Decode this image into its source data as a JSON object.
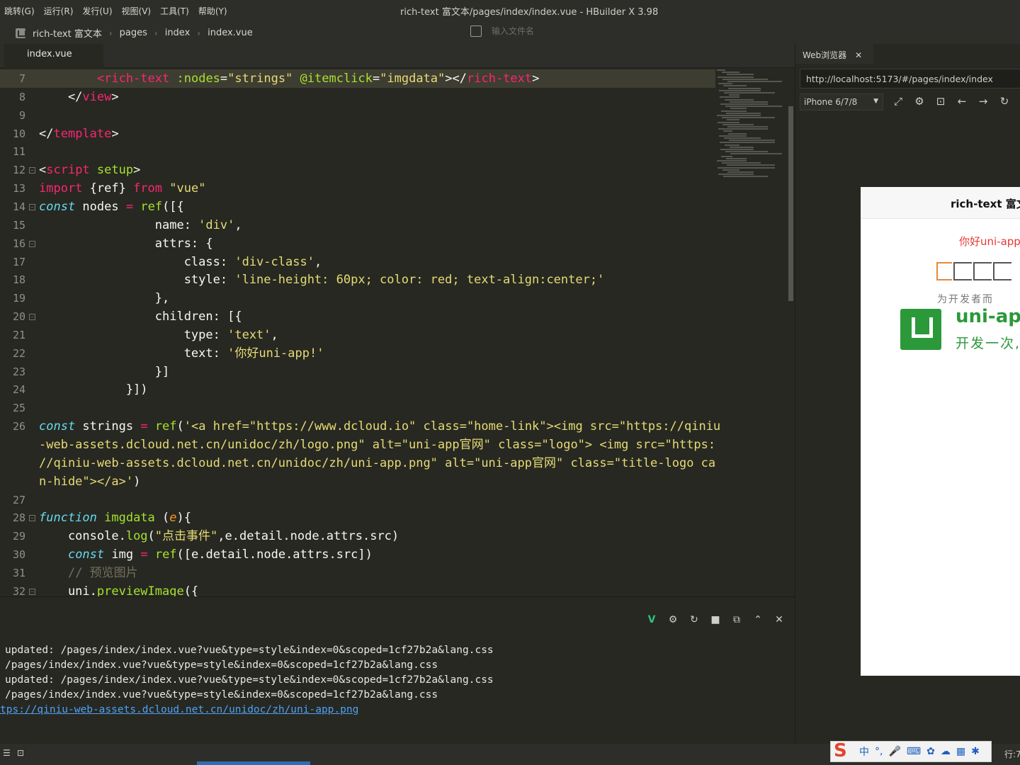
{
  "menu": {
    "items": [
      "跳转(G)",
      "运行(R)",
      "发行(U)",
      "视图(V)",
      "工具(T)",
      "帮助(Y)"
    ],
    "window_title": "rich-text 富文本/pages/index/index.vue - HBuilder X 3.98"
  },
  "breadcrumb": {
    "items": [
      "rich-text 富文本",
      "pages",
      "index",
      "index.vue"
    ],
    "file_search_placeholder": "输入文件名"
  },
  "editor": {
    "tab": "index.vue",
    "lines": [
      {
        "n": "7",
        "html": "        <span class='tag'>&lt;rich-text</span> <span class='attr'>:nodes</span>=<span class='str'>\"strings\"</span> <span class='attr'>@itemclick</span>=<span class='str'>\"imgdata\"</span>&gt;&lt;/<span class='tag'>rich-text</span>&gt;",
        "cur": true
      },
      {
        "n": "8",
        "html": "    &lt;/<span class='tag'>view</span>&gt;"
      },
      {
        "n": "9",
        "html": ""
      },
      {
        "n": "10",
        "html": "&lt;/<span class='tag'>template</span>&gt;"
      },
      {
        "n": "11",
        "html": ""
      },
      {
        "n": "12",
        "html": "&lt;<span class='tag'>script</span> <span class='attr'>setup</span>&gt;",
        "fold": true
      },
      {
        "n": "13",
        "html": "<span class='red'>import</span> {ref} <span class='red'>from</span> <span class='str'>\"vue\"</span>"
      },
      {
        "n": "14",
        "html": "<span class='kw'>const</span> nodes <span class='red'>=</span> <span class='fn'>ref</span>([{",
        "fold": true
      },
      {
        "n": "15",
        "html": "                name: <span class='str'>'div'</span>,"
      },
      {
        "n": "16",
        "html": "                attrs: {",
        "fold": true
      },
      {
        "n": "17",
        "html": "                    class: <span class='str'>'div-class'</span>,"
      },
      {
        "n": "18",
        "html": "                    style: <span class='str'>'line-height: 60px; color: red; text-align:center;'</span>"
      },
      {
        "n": "19",
        "html": "                },"
      },
      {
        "n": "20",
        "html": "                children: [{",
        "fold": true
      },
      {
        "n": "21",
        "html": "                    type: <span class='str'>'text'</span>,"
      },
      {
        "n": "22",
        "html": "                    text: <span class='str'>'你好uni-app!'</span>"
      },
      {
        "n": "23",
        "html": "                }]"
      },
      {
        "n": "24",
        "html": "            }])"
      },
      {
        "n": "25",
        "html": ""
      },
      {
        "n": "26",
        "html": "<span class='kw'>const</span> strings <span class='red'>=</span> <span class='fn'>ref</span>(<span class='str'>'&lt;a href=\"https://www.dcloud.io\" class=\"home-link\"&gt;&lt;img src=\"https://qiniu</span>"
      },
      {
        "n": "",
        "html": "<span class='str'>-web-assets.dcloud.net.cn/unidoc/zh/logo.png\" alt=\"uni-app官网\" class=\"logo\"&gt; &lt;img src=\"https:</span>"
      },
      {
        "n": "",
        "html": "<span class='str'>//qiniu-web-assets.dcloud.net.cn/unidoc/zh/uni-app.png\" alt=\"uni-app官网\" class=\"title-logo ca</span>"
      },
      {
        "n": "",
        "html": "<span class='str'>n-hide\"&gt;&lt;/a&gt;'</span>)"
      },
      {
        "n": "27",
        "html": ""
      },
      {
        "n": "28",
        "html": "<span class='kw'>function</span> <span class='fn'>imgdata</span> (<span class='par'>e</span>){",
        "fold": true
      },
      {
        "n": "29",
        "html": "    console.<span class='fn'>log</span>(<span class='str'>\"点击事件\"</span>,e.detail.node.attrs.src)"
      },
      {
        "n": "30",
        "html": "    <span class='kw'>const</span> img <span class='red'>=</span> <span class='fn'>ref</span>([e.detail.node.attrs.src])"
      },
      {
        "n": "31",
        "html": "    <span class='com'>// 预览图片</span>"
      },
      {
        "n": "32",
        "html": "    uni.<span class='fn'>previewImage</span>({",
        "fold": true
      }
    ]
  },
  "console": {
    "lines": [
      "updated: /pages/index/index.vue?vue&type=style&index=0&scoped=1cf27b2a&lang.css",
      "/pages/index/index.vue?vue&type=style&index=0&scoped=1cf27b2a&lang.css",
      "updated: /pages/index/index.vue?vue&type=style&index=0&scoped=1cf27b2a&lang.css",
      "/pages/index/index.vue?vue&type=style&index=0&scoped=1cf27b2a&lang.css"
    ],
    "link": "tps://qiniu-web-assets.dcloud.net.cn/unidoc/zh/uni-app.png"
  },
  "browser": {
    "tab": "Web浏览器",
    "url": "http://localhost:5173/#/pages/index/index",
    "device": "iPhone 6/7/8",
    "page_title": "rich-text 富文",
    "hello_text": "你好uni-app",
    "dcloud_sub": "为开发者而",
    "uni_title": "uni-app",
    "uni_sub": "开发一次,"
  },
  "status": {
    "ime_label": "中",
    "row_info": "行:7"
  },
  "colors": {
    "accent_green": "#2b9939",
    "link_blue": "#4ea1f3",
    "keyword_red": "#f92672"
  }
}
